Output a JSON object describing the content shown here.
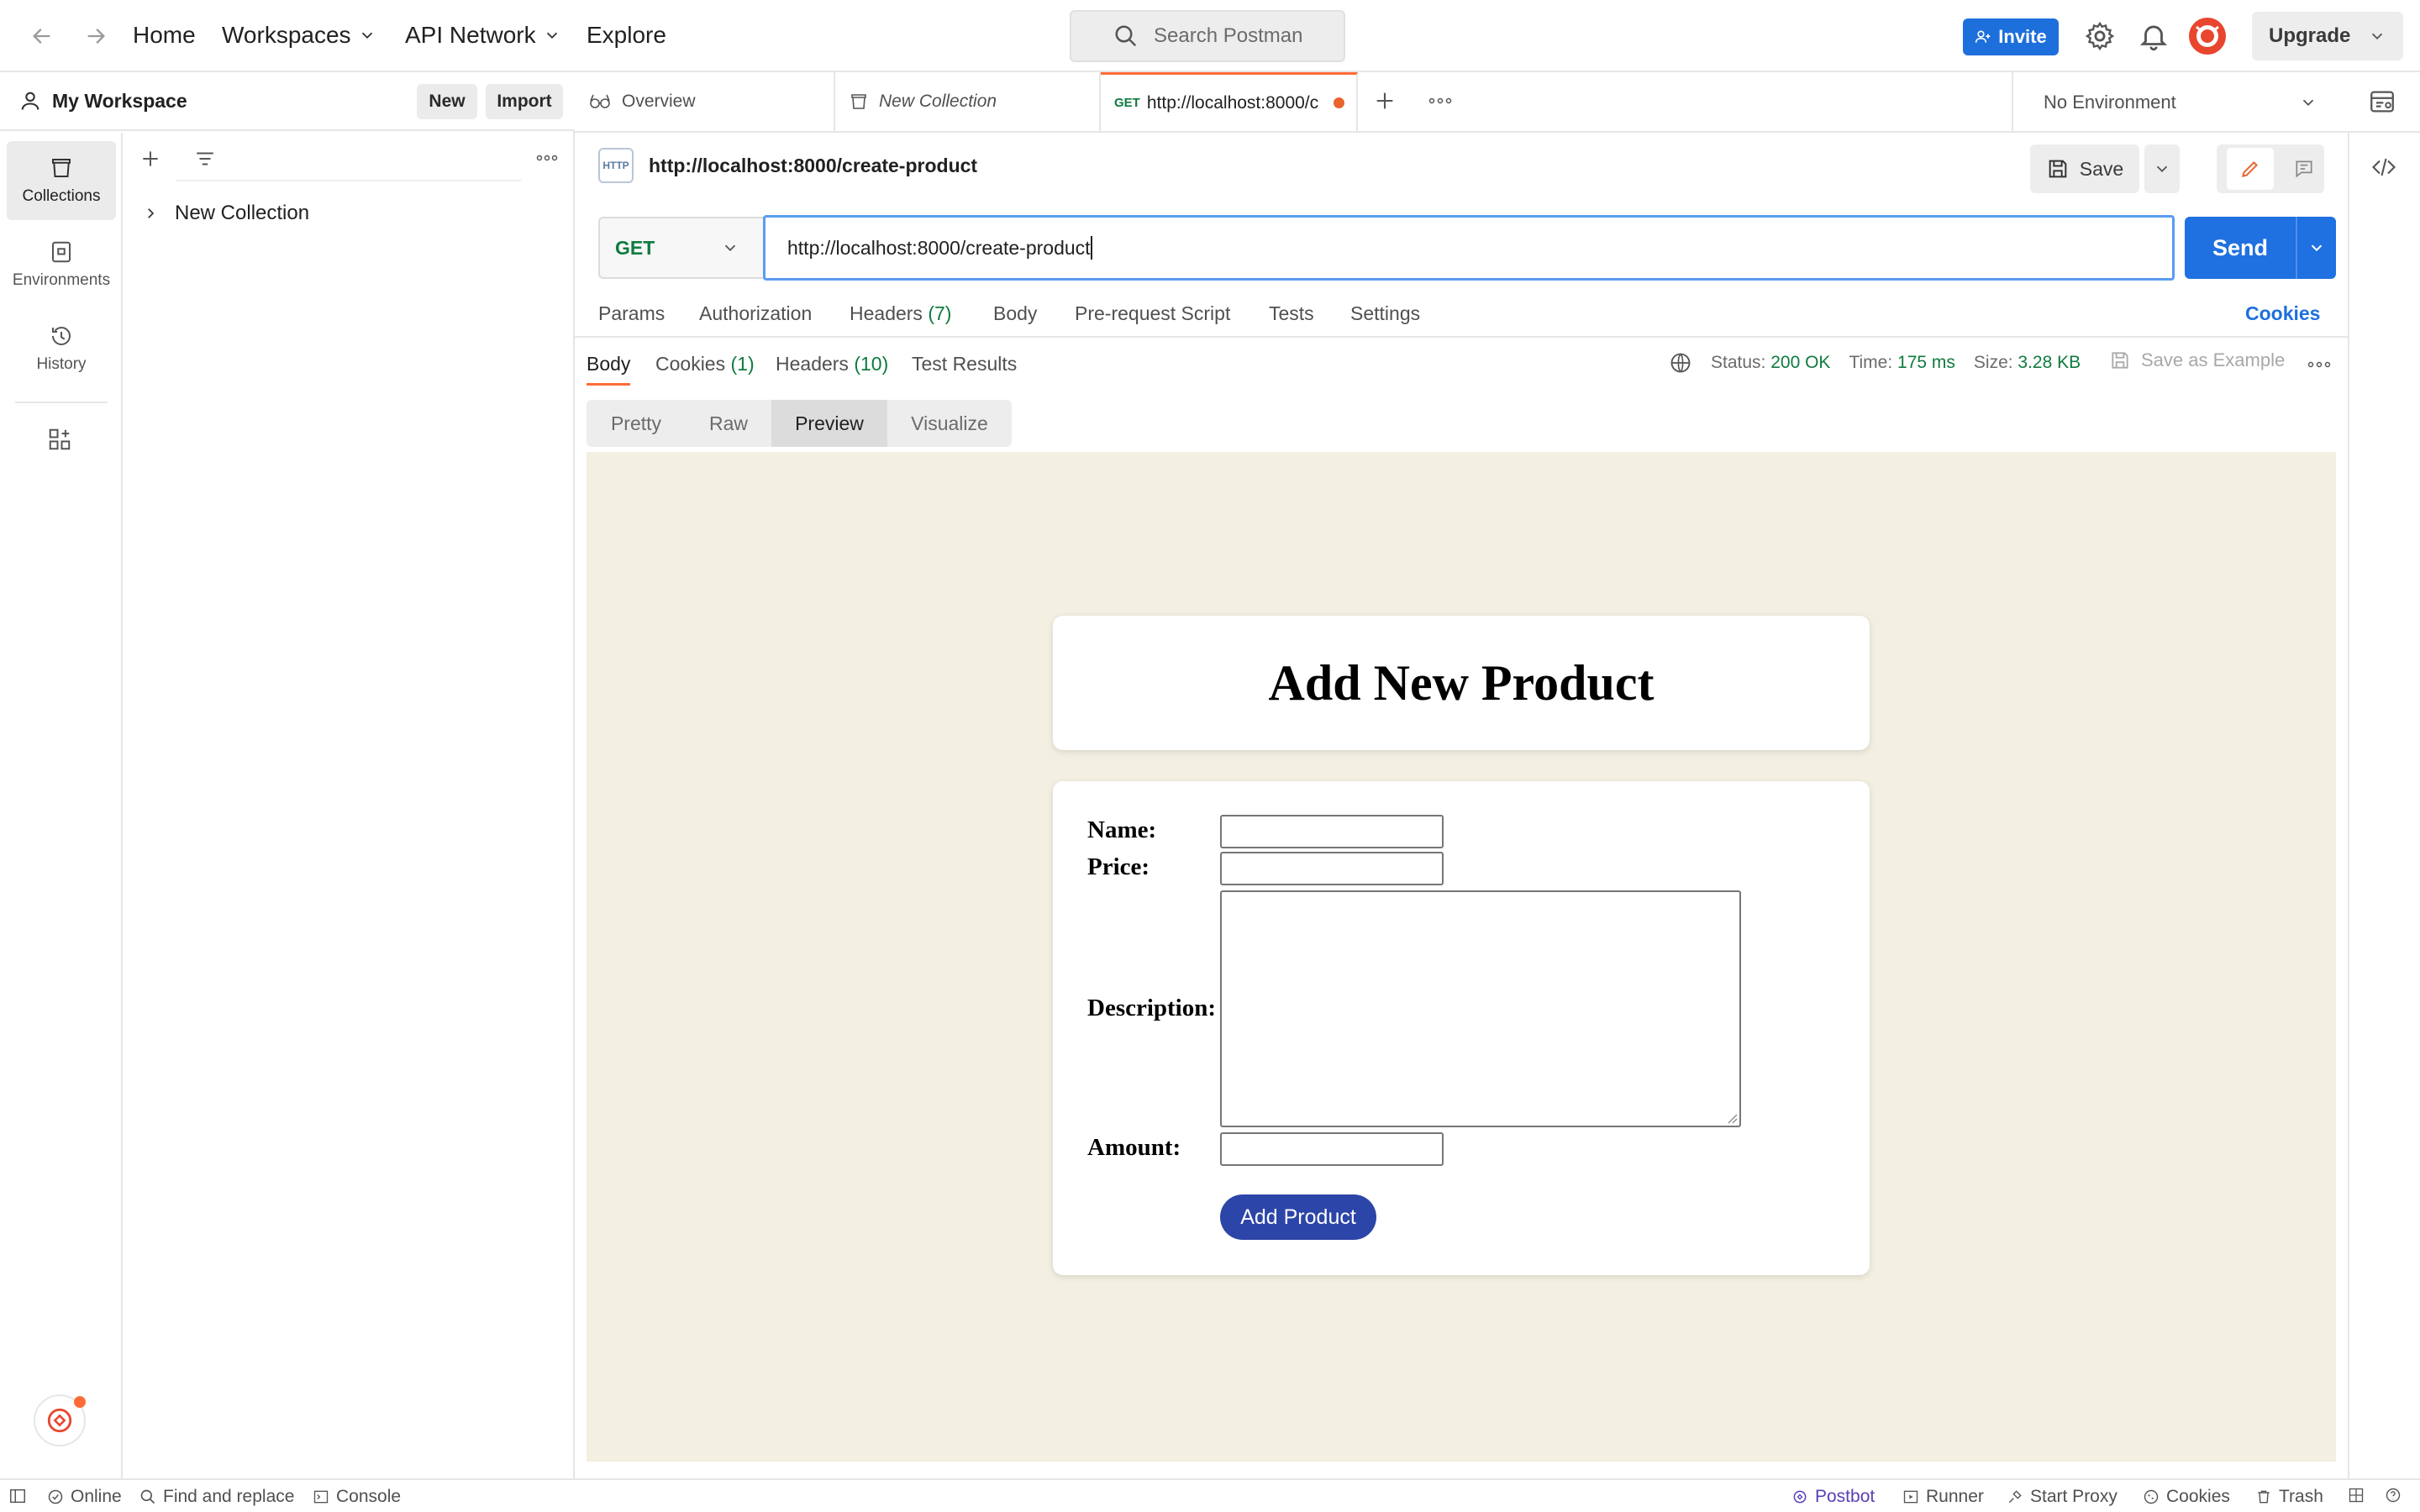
{
  "topbar": {
    "home": "Home",
    "workspaces": "Workspaces",
    "api_network": "API Network",
    "explore": "Explore",
    "search_placeholder": "Search Postman",
    "invite": "Invite",
    "upgrade": "Upgrade"
  },
  "sidebar": {
    "workspace_title": "My Workspace",
    "new_btn": "New",
    "import_btn": "Import",
    "rail": [
      {
        "label": "Collections",
        "icon": "collections-icon"
      },
      {
        "label": "Environments",
        "icon": "environments-icon"
      },
      {
        "label": "History",
        "icon": "history-icon"
      }
    ],
    "collections": [
      {
        "label": "New Collection"
      }
    ]
  },
  "tabs": {
    "overview": "Overview",
    "new_collection": "New Collection",
    "request_method": "GET",
    "request_label": "http://localhost:8000/c",
    "environment": "No Environment"
  },
  "request": {
    "title": "http://localhost:8000/create-product",
    "http_badge": "HTTP",
    "save": "Save",
    "method": "GET",
    "url": "http://localhost:8000/create-product",
    "send": "Send",
    "tabs": {
      "params": "Params",
      "authorization": "Authorization",
      "headers": "Headers",
      "headers_count": "(7)",
      "body": "Body",
      "prerequest": "Pre-request Script",
      "tests": "Tests",
      "settings": "Settings",
      "cookies": "Cookies"
    }
  },
  "response": {
    "tabs": {
      "body": "Body",
      "cookies": "Cookies",
      "cookies_count": "(1)",
      "headers": "Headers",
      "headers_count": "(10)",
      "test_results": "Test Results"
    },
    "status_label": "Status:",
    "status_value": "200 OK",
    "time_label": "Time:",
    "time_value": "175 ms",
    "size_label": "Size:",
    "size_value": "3.28 KB",
    "save_example": "Save as Example",
    "view_modes": [
      "Pretty",
      "Raw",
      "Preview",
      "Visualize"
    ],
    "active_view": "Preview"
  },
  "preview": {
    "heading": "Add New Product",
    "name_label": "Name:",
    "price_label": "Price:",
    "description_label": "Description:",
    "amount_label": "Amount:",
    "submit": "Add Product"
  },
  "statusbar": {
    "online": "Online",
    "find_replace": "Find and replace",
    "console": "Console",
    "postbot": "Postbot",
    "runner": "Runner",
    "start_proxy": "Start Proxy",
    "cookies": "Cookies",
    "trash": "Trash"
  },
  "colors": {
    "accent": "#ff6c37",
    "send_blue": "#1f70e0",
    "ok_green": "#0f7b3f",
    "preview_bg": "#f3efe1",
    "submit_blue": "#2c45a8"
  }
}
